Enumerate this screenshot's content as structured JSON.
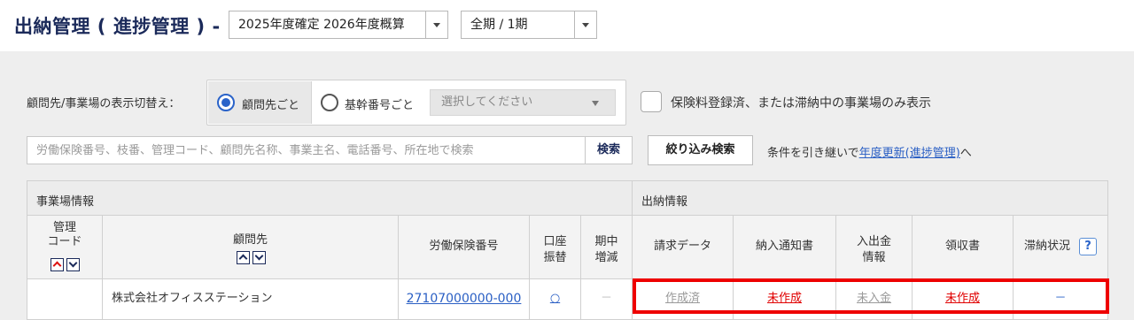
{
  "header": {
    "title": "出納管理 ( 進捗管理 ) -",
    "year_select": "2025年度確定 2026年度概算",
    "period_select": "全期 / 1期"
  },
  "filters": {
    "switch_label": "顧問先/事業場の表示切替え：",
    "radio_client": "顧問先ごと",
    "radio_base": "基幹番号ごと",
    "select_placeholder": "選択してください",
    "checkbox_label": "保険料登録済、または滞納中の事業場のみ表示",
    "search_placeholder": "労働保険番号、枝番、管理コード、顧問先名称、事業主名、電話番号、所在地で検索",
    "search_button": "検索",
    "filter_button": "絞り込み検索",
    "carry_prefix": "条件を引き継いで",
    "carry_link": "年度更新(進捗管理)",
    "carry_suffix": "へ"
  },
  "table": {
    "group_business": "事業場情報",
    "group_payment": "出納情報",
    "columns": {
      "code_line1": "管理",
      "code_line2": "コード",
      "client": "顧問先",
      "insurance_no": "労働保険番号",
      "transfer_line1": "口座",
      "transfer_line2": "振替",
      "change_line1": "期中",
      "change_line2": "増減",
      "billing": "請求データ",
      "notice": "納入通知書",
      "deposit_line1": "入出金",
      "deposit_line2": "情報",
      "receipt": "領収書",
      "arrears": "滞納状況",
      "help": "?"
    },
    "rows": [
      {
        "code": "",
        "client": "株式会社オフィスステーション",
        "insurance_no": "27107000000-000",
        "transfer": "○",
        "change": "－",
        "billing": "作成済",
        "notice": "未作成",
        "deposit": "未入金",
        "receipt": "未作成",
        "arrears": "－"
      }
    ]
  },
  "colors": {
    "title": "#1b2a5a",
    "link": "#2a5fc4",
    "alert": "#e00000",
    "highlight_frame": "#ee0000"
  }
}
